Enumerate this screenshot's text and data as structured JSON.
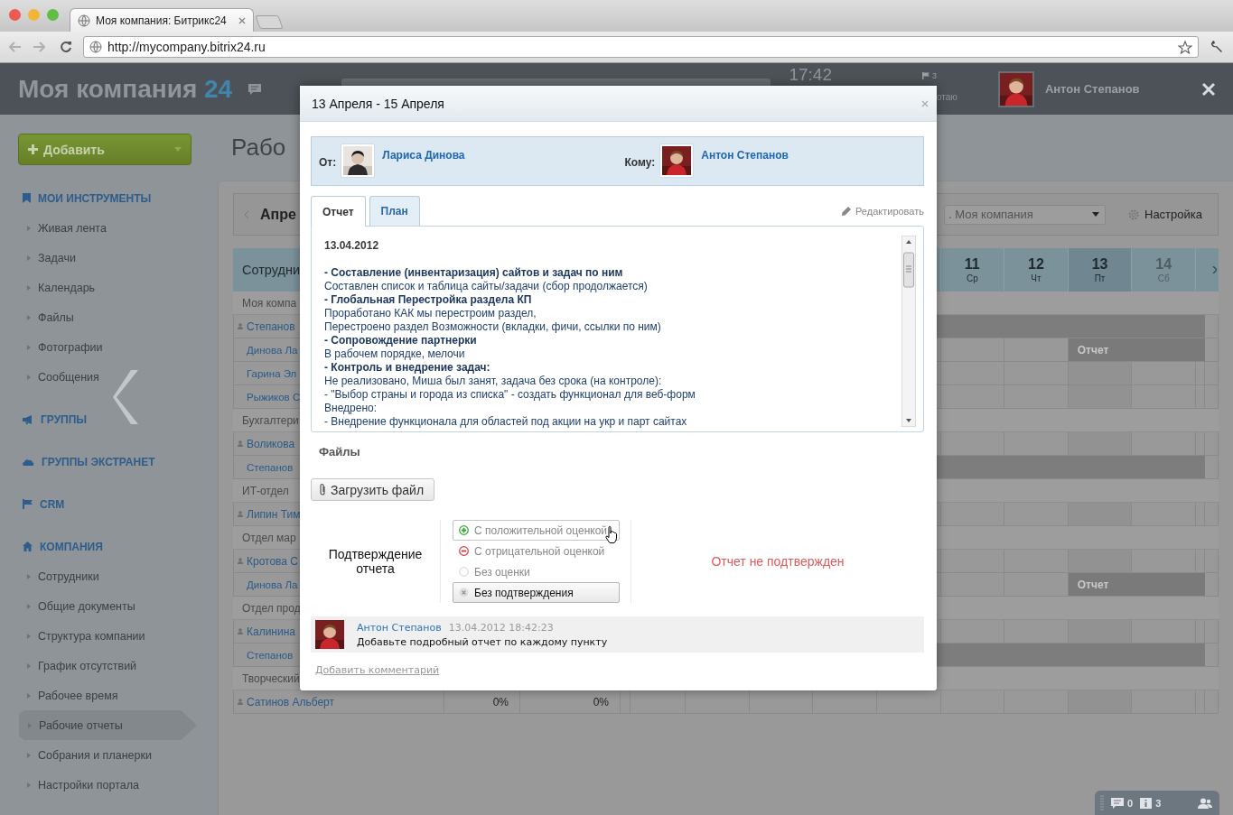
{
  "browser": {
    "tab_title": "Моя компания: Битрикс24",
    "url": "http://mycompany.bitrix24.ru"
  },
  "header": {
    "logo": "Моя компания",
    "logo_number": "24",
    "clock": "17:42",
    "flag_count": "3",
    "status": "отаю",
    "user": "Антон Степанов"
  },
  "sidebar": {
    "add_button": "Добавить",
    "sections": [
      {
        "title": "МОИ ИНСТРУМЕНТЫ",
        "kind": "bookmark",
        "items": [
          {
            "label": "Живая лента",
            "selected": false
          },
          {
            "label": "Задачи",
            "selected": false
          },
          {
            "label": "Календарь",
            "selected": false
          },
          {
            "label": "Файлы",
            "selected": false
          },
          {
            "label": "Фотографии",
            "selected": false
          },
          {
            "label": "Сообщения",
            "selected": false
          }
        ]
      },
      {
        "title": "ГРУППЫ",
        "kind": "megaphone"
      },
      {
        "title": "ГРУППЫ ЭКСТРАНЕТ",
        "kind": "cloud"
      },
      {
        "title": "CRM",
        "kind": "flag"
      },
      {
        "title": "КОМПАНИЯ",
        "kind": "house",
        "items": [
          {
            "label": "Сотрудники",
            "selected": false
          },
          {
            "label": "Общие документы",
            "selected": false
          },
          {
            "label": "Структура компании",
            "selected": false
          },
          {
            "label": "График отсутствий",
            "selected": false
          },
          {
            "label": "Рабочее время",
            "selected": false
          },
          {
            "label": "Рабочие отчеты",
            "selected": true
          },
          {
            "label": "Собрания и планерки",
            "selected": false
          },
          {
            "label": "Настройки портала",
            "selected": false
          }
        ]
      }
    ]
  },
  "page": {
    "title": "Рабо",
    "period": "Апре",
    "company_filter": ". Моя компания",
    "settings": "Настройка"
  },
  "table": {
    "first_column": "Сотрудни",
    "days": [
      {
        "day": "11",
        "weekday": "Ср",
        "selected": false,
        "weekend": false
      },
      {
        "day": "12",
        "weekday": "Чт",
        "selected": false,
        "weekend": false
      },
      {
        "day": "13",
        "weekday": "Пт",
        "selected": true,
        "weekend": false
      },
      {
        "day": "14",
        "weekday": "Сб",
        "selected": false,
        "weekend": true
      }
    ],
    "rows": [
      {
        "kind": "group",
        "name": "Моя компа"
      },
      {
        "kind": "head",
        "name": "Степанов",
        "absent": true
      },
      {
        "kind": "member",
        "name": "Динова Ла",
        "absent": false,
        "report": "Отчет"
      },
      {
        "kind": "member",
        "name": "Гарина Эл",
        "absent": false
      },
      {
        "kind": "member",
        "name": "Рыжиков С",
        "absent": false
      },
      {
        "kind": "group",
        "name": "Бухгалтери"
      },
      {
        "kind": "head",
        "name": "Воликова",
        "absent": false
      },
      {
        "kind": "member",
        "name": "Степанов",
        "absent": true
      },
      {
        "kind": "group",
        "name": "ИТ-отдел"
      },
      {
        "kind": "head",
        "name": "Липин Тим",
        "absent": false
      },
      {
        "kind": "group",
        "name": "Отдел мар"
      },
      {
        "kind": "head",
        "name": "Кротова С",
        "absent": false
      },
      {
        "kind": "member",
        "name": "Динова Ла",
        "absent": false,
        "report": "Отчет"
      },
      {
        "kind": "group",
        "name": "Отдел прод"
      },
      {
        "kind": "head",
        "name": "Калинина",
        "absent": false
      },
      {
        "kind": "member",
        "name": "Степанов",
        "absent": true
      },
      {
        "kind": "group",
        "name": "Творческий"
      },
      {
        "kind": "head",
        "name": "Сатинов Альберт",
        "absent": false,
        "values": [
          "0%",
          "0%"
        ]
      }
    ]
  },
  "dialog": {
    "title": "13 Апреля - 15 Апреля",
    "from_label": "От:",
    "from_name": "Лариса Динова",
    "to_label": "Кому:",
    "to_name": "Антон Степанов",
    "tabs": [
      {
        "label": "Отчет",
        "selected": true
      },
      {
        "label": "План",
        "selected": false
      }
    ],
    "edit_link": "Редактировать",
    "report_lines": [
      {
        "kind": "date",
        "text": "13.04.2012"
      },
      {
        "kind": "heading",
        "text": "- Составление (инвентаризация) сайтов и задач по ним"
      },
      {
        "kind": "text",
        "text": "Составлен список и таблица сайты/задачи (сбор продолжается)"
      },
      {
        "kind": "heading",
        "text": "- Глобальная Перестройка раздела КП"
      },
      {
        "kind": "text",
        "text": "Проработано КАК мы перестроим раздел,"
      },
      {
        "kind": "text",
        "text": "Перестроено раздел Возможности (вкладки, фичи, ссылки по ним)"
      },
      {
        "kind": "heading",
        "text": "- Сопровождение партнерки"
      },
      {
        "kind": "text",
        "text": "В рабочем порядке, мелочи"
      },
      {
        "kind": "heading",
        "text": "- Контроль и внедрение задач:"
      },
      {
        "kind": "text",
        "text": "Не реализовано, Миша был занят, задача без срока (на контроле):"
      },
      {
        "kind": "text",
        "text": "- \"Выбор страны и города из списка\" - создать функционал для веб-форм"
      },
      {
        "kind": "text",
        "text": "Внедрено:"
      },
      {
        "kind": "text",
        "text": "- Внедрение функционала для областей под акции на укр и парт сайтах"
      }
    ],
    "files_title": "Файлы",
    "upload_button": "Загрузить файл",
    "confirmation": {
      "label": "Подтверждение отчета",
      "options": [
        {
          "kind": "positive",
          "label": "С положительной оценкой",
          "selected": false,
          "hovered": true
        },
        {
          "kind": "negative",
          "label": "С отрицательной оценкой",
          "selected": false,
          "hovered": false
        },
        {
          "kind": "none",
          "label": "Без оценки",
          "selected": false,
          "hovered": false
        },
        {
          "kind": "cancel",
          "label": "Без подтверждения",
          "selected": true,
          "hovered": false
        }
      ],
      "status": "Отчет не подтвержден"
    },
    "comment": {
      "author": "Антон Степанов",
      "date": "13.04.2012 18:42:23",
      "text": "Добавьте подробный отчет по каждому пункту"
    },
    "add_comment": "Добавить комментарий"
  },
  "footer_bar": {
    "messages": "0",
    "notifications": "3"
  }
}
